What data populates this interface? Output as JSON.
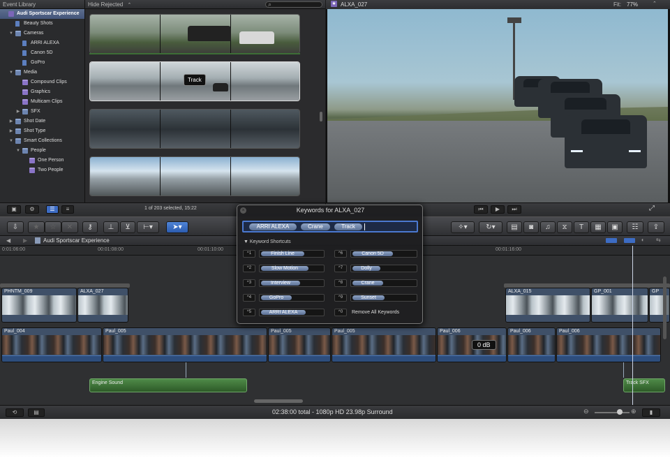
{
  "library": {
    "header": "Event Library",
    "items": [
      {
        "label": "Audi Sportscar Experience",
        "indent": 0,
        "icon": "star-event-icon",
        "tri": "",
        "selected": true
      },
      {
        "label": "Beauty Shots",
        "indent": 1,
        "icon": "keyword-icon",
        "tri": "",
        "selected": false
      },
      {
        "label": "Cameras",
        "indent": 1,
        "icon": "folder-icon",
        "tri": "▼",
        "selected": false
      },
      {
        "label": "ARRI ALEXA",
        "indent": 2,
        "icon": "keyword-icon",
        "tri": "",
        "selected": false
      },
      {
        "label": "Canon 5D",
        "indent": 2,
        "icon": "keyword-icon",
        "tri": "",
        "selected": false
      },
      {
        "label": "GoPro",
        "indent": 2,
        "icon": "keyword-icon",
        "tri": "",
        "selected": false
      },
      {
        "label": "Media",
        "indent": 1,
        "icon": "folder-icon",
        "tri": "▼",
        "selected": false
      },
      {
        "label": "Compound Clips",
        "indent": 2,
        "icon": "smart-collection-icon",
        "tri": "",
        "selected": false
      },
      {
        "label": "Graphics",
        "indent": 2,
        "icon": "smart-collection-icon",
        "tri": "",
        "selected": false
      },
      {
        "label": "Multicam Clips",
        "indent": 2,
        "icon": "smart-collection-icon",
        "tri": "",
        "selected": false
      },
      {
        "label": "SFX",
        "indent": 2,
        "icon": "folder-icon",
        "tri": "▶",
        "selected": false
      },
      {
        "label": "Shot Date",
        "indent": 1,
        "icon": "folder-icon",
        "tri": "▶",
        "selected": false
      },
      {
        "label": "Shot Type",
        "indent": 1,
        "icon": "folder-icon",
        "tri": "▶",
        "selected": false
      },
      {
        "label": "Smart Collections",
        "indent": 1,
        "icon": "folder-icon",
        "tri": "▼",
        "selected": false
      },
      {
        "label": "People",
        "indent": 2,
        "icon": "folder-icon",
        "tri": "▼",
        "selected": false
      },
      {
        "label": "One Person",
        "indent": 3,
        "icon": "smart-collection-icon",
        "tri": "",
        "selected": false
      },
      {
        "label": "Two People",
        "indent": 3,
        "icon": "smart-collection-icon",
        "tri": "",
        "selected": false
      }
    ]
  },
  "browser": {
    "filter": "Hide Rejected",
    "filter_arrows": "⌃",
    "tooltip": "Track",
    "status": "1 of 203 selected, 15:22",
    "search_icon": "⌕"
  },
  "viewer": {
    "title": "ALXA_027",
    "fit_label": "Fit:",
    "fit_value": "77%",
    "prev": "⏮",
    "play": "▶",
    "next": "⏭",
    "fullscreen": "⤢"
  },
  "toolbar": {
    "import": "⇩",
    "favorite": "★",
    "unrate": "☆",
    "reject": "✕",
    "keyword": "🔑",
    "tool": "➤",
    "titles": "T",
    "share": "⇪"
  },
  "timeline": {
    "title": "Audi Sportscar Experience",
    "ruler": [
      "0:01:06:00",
      "00:01:08:00",
      "00:01:10:00",
      "00:01:16:00"
    ],
    "db_badge": "0 dB",
    "status": "02:38:00 total - 1080p HD 23.98p Surround",
    "video_clips": [
      {
        "name": "PHNTM_009",
        "type": "cars"
      },
      {
        "name": "ALXA_027",
        "type": "cars"
      },
      {
        "name": "ALXA_015",
        "type": "cars"
      },
      {
        "name": "GP_001",
        "type": "cars"
      },
      {
        "name": "GP",
        "type": "cars"
      }
    ],
    "primary_clips": [
      {
        "name": "Paul_004"
      },
      {
        "name": "Paul_005"
      },
      {
        "name": "Paul_005"
      },
      {
        "name": "Paul_005"
      },
      {
        "name": "Paul_006"
      },
      {
        "name": "Paul_006"
      },
      {
        "name": "Paul_006"
      }
    ],
    "audio_clips": [
      {
        "name": "Engine Sound"
      },
      {
        "name": "Track SFX"
      }
    ]
  },
  "keywords_hud": {
    "title": "Keywords for ALXA_027",
    "tokens": [
      "ARRI ALEXA",
      "Crane",
      "Track"
    ],
    "section": "Keyword Shortcuts",
    "shortcuts": [
      {
        "key": "^1",
        "label": "Finish Line"
      },
      {
        "key": "^2",
        "label": "Slow Motion"
      },
      {
        "key": "^3",
        "label": "Interview"
      },
      {
        "key": "^4",
        "label": "GoPro"
      },
      {
        "key": "^5",
        "label": "ARRI ALEXA"
      },
      {
        "key": "^6",
        "label": "Canon 5D"
      },
      {
        "key": "^7",
        "label": "Dolly"
      },
      {
        "key": "^8",
        "label": "Crane"
      },
      {
        "key": "^9",
        "label": "Sunset"
      },
      {
        "key": "^0",
        "label": "Remove All Keywords"
      }
    ]
  },
  "colors": {
    "accent": "#3d6cc4",
    "selection": "#44557a",
    "audio": "#2d5a28"
  }
}
